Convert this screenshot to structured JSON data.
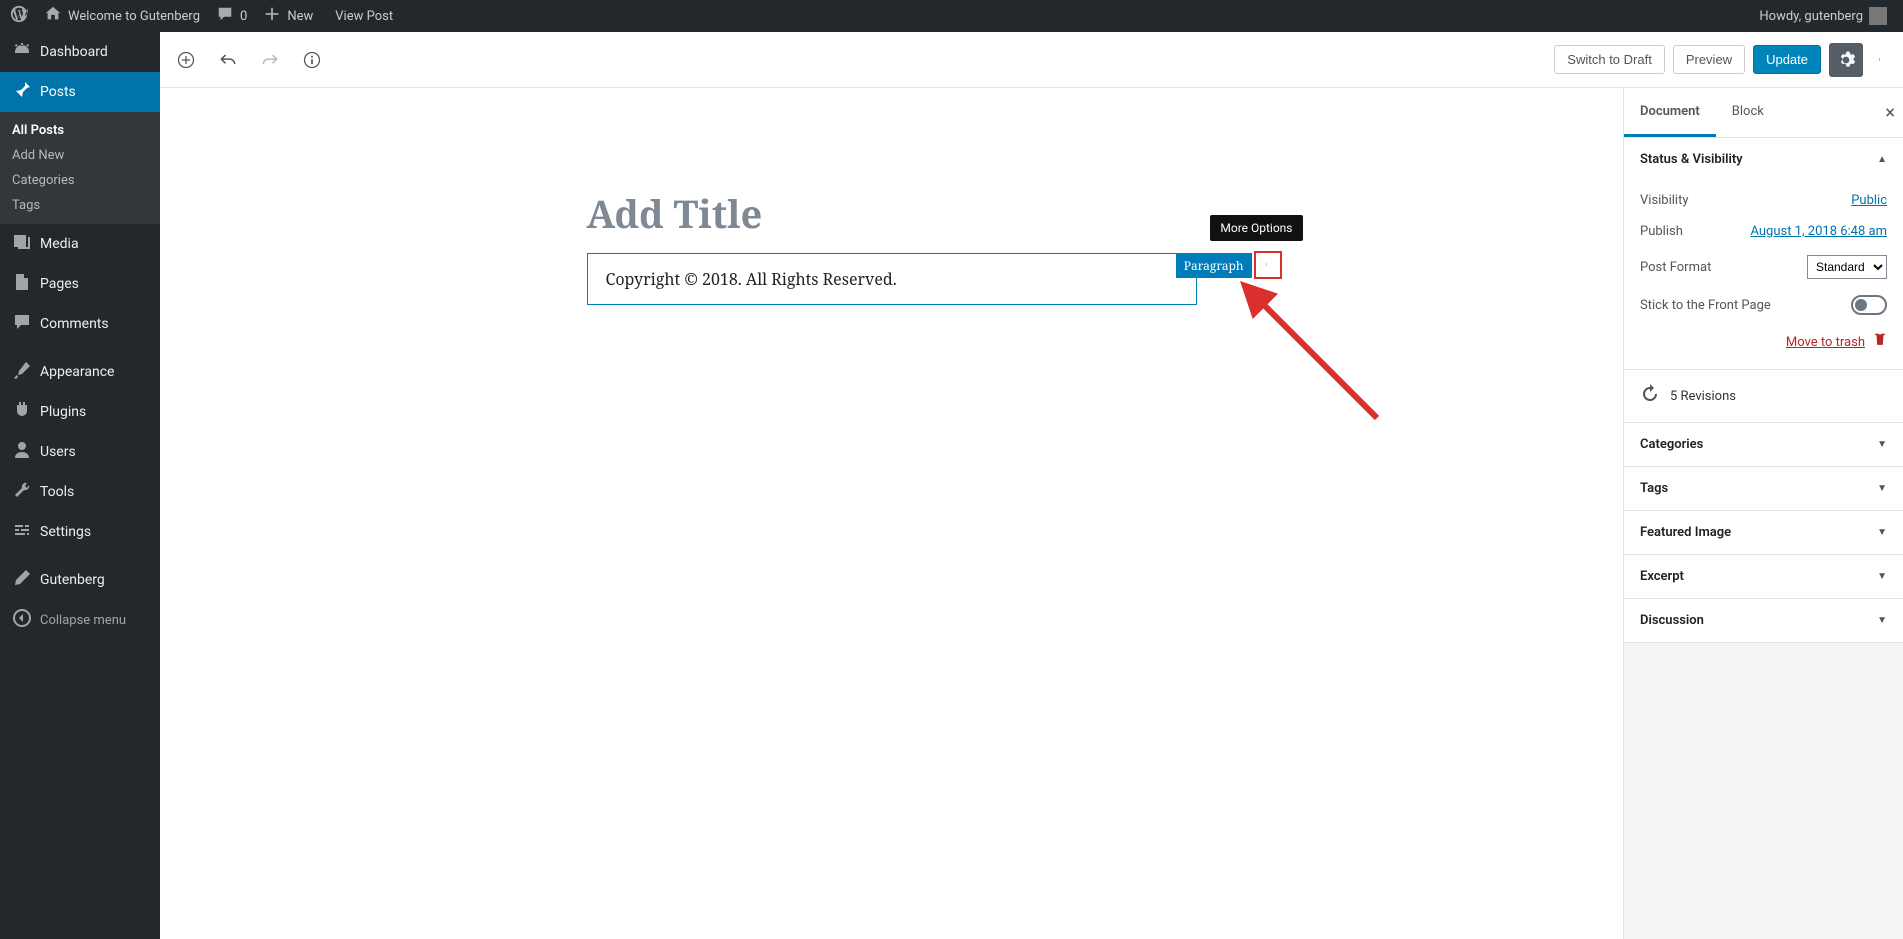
{
  "adminBar": {
    "siteName": "Welcome to Gutenberg",
    "commentsCount": "0",
    "newLabel": "New",
    "viewPostLabel": "View Post",
    "howdy": "Howdy, gutenberg"
  },
  "sidebar": {
    "dashboard": "Dashboard",
    "postsLabel": "Posts",
    "posts": {
      "all": "All Posts",
      "add": "Add New",
      "categories": "Categories",
      "tags": "Tags"
    },
    "media": "Media",
    "pages": "Pages",
    "comments": "Comments",
    "appearance": "Appearance",
    "plugins": "Plugins",
    "users": "Users",
    "tools": "Tools",
    "settings": "Settings",
    "gutenberg": "Gutenberg",
    "collapse": "Collapse menu"
  },
  "editorHeader": {
    "switchDraft": "Switch to Draft",
    "preview": "Preview",
    "update": "Update"
  },
  "content": {
    "titlePlaceholder": "Add Title",
    "paragraphText": "Copyright © 2018. All Rights Reserved.",
    "blockBadge": "Paragraph",
    "moreOptionsTooltip": "More Options"
  },
  "settings": {
    "tabs": {
      "document": "Document",
      "block": "Block"
    },
    "statusVis": {
      "header": "Status & Visibility",
      "visibility": "Visibility",
      "visibilityValue": "Public",
      "publish": "Publish",
      "publishValue": "August 1, 2018 6:48 am",
      "postFormat": "Post Format",
      "postFormatValue": "Standard",
      "stick": "Stick to the Front Page",
      "trash": "Move to trash"
    },
    "revisions": "5 Revisions",
    "panels": {
      "categories": "Categories",
      "tags": "Tags",
      "featured": "Featured Image",
      "excerpt": "Excerpt",
      "discussion": "Discussion"
    }
  }
}
